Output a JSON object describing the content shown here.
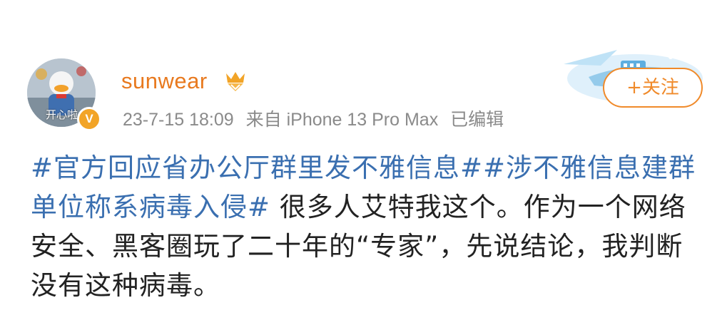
{
  "user": {
    "name": "sunwear",
    "avatar_caption": "开心啦",
    "verified_mark": "V"
  },
  "meta": {
    "time": "23-7-15 18:09",
    "source": "来自 iPhone 13 Pro Max",
    "edited": "已编辑"
  },
  "follow": {
    "label": "+关注"
  },
  "post": {
    "hashtag1": "#官方回应省办公厅群里发不雅信息#",
    "hashtag2": "#涉不雅信息建群单位称系病毒入侵#",
    "text": " 很多人艾特我这个。作为一个网络安全、黑客圈玩了二十年的“专家”，先说结论，我判断没有这种病毒。"
  },
  "colors": {
    "username": "#e8791e",
    "hashtag": "#3a6fb0",
    "follow": "#f08a2a",
    "meta": "#8a8a8a"
  },
  "icons": [
    "avatar",
    "verified-icon",
    "vip-badge-icon",
    "airship-illustration"
  ]
}
